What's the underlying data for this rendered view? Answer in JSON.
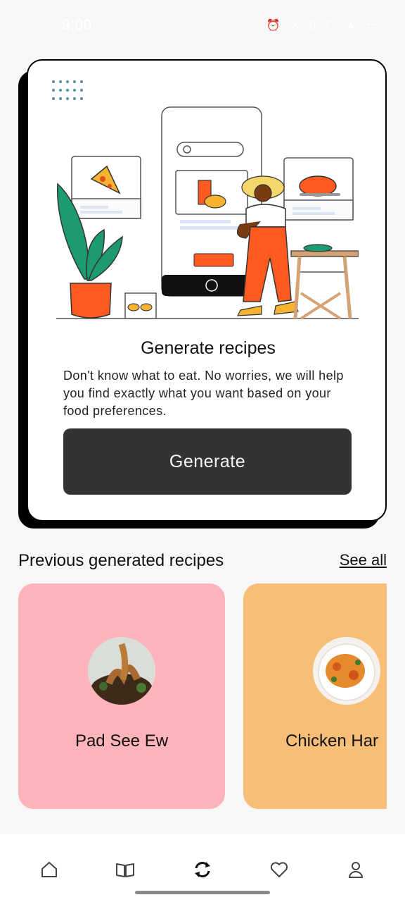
{
  "status_bar": {
    "time": "9:00",
    "icons": [
      "alarm-icon",
      "mute-icon",
      "vibrate-icon",
      "wifi-icon",
      "signal-icon",
      "battery-icon"
    ]
  },
  "hero": {
    "title": "Generate recipes",
    "description": "Don't know what to eat. No worries, we will help you find exactly what you want based on your food preferences.",
    "button_label": "Generate"
  },
  "section": {
    "title": "Previous generated recipes",
    "see_all": "See all"
  },
  "recipes": [
    {
      "name": "Pad See Ew",
      "color": "#ffb3ba"
    },
    {
      "name": "Chicken Har",
      "color": "#f7be78"
    }
  ],
  "nav": {
    "items": [
      "home-icon",
      "book-icon",
      "generate-icon",
      "heart-icon",
      "profile-icon"
    ],
    "active": "generate-icon"
  },
  "colors": {
    "button_bg": "#333333",
    "accent_orange": "#ff5a1f",
    "card_pink": "#ffb3ba",
    "card_orange": "#f7be78"
  }
}
